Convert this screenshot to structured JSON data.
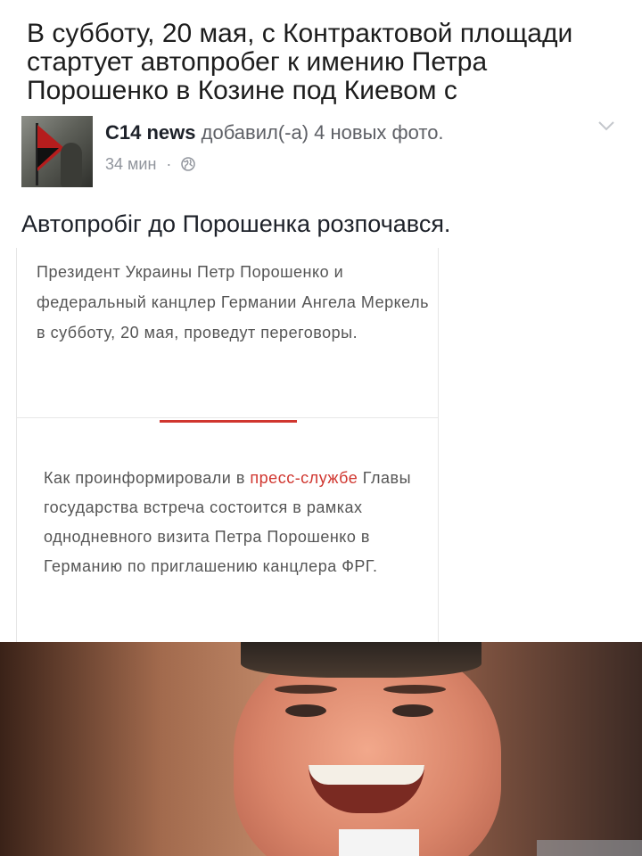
{
  "headline": "В субботу, 20 мая, с Контрактовой площади стартует автопробег к имению Петра Порошенко в Козине под Киевом с",
  "post": {
    "author": "C14 news",
    "action": "добавил(-а) 4 новых фото.",
    "time": "34 мин",
    "separator": "·",
    "text": "Автопробіг до Порошенка розпочався."
  },
  "article": {
    "paragraph1": "Президент Украины Петр Порошенко и федеральный канцлер Германии Ангела Меркель в субботу, 20 мая, проведут переговоры.",
    "paragraph2_before": "Как проинформировали в ",
    "paragraph2_link": "пресс-службе",
    "paragraph2_after": " Главы государства встреча состоится в рамках однодневного визита Петра Порошенко в Германию по приглашению канцлера ФРГ."
  },
  "icons": {
    "privacy": "globe-icon",
    "menu": "chevron-down-icon"
  },
  "colors": {
    "link_red": "#d0362f",
    "meta_gray": "#90949c"
  }
}
